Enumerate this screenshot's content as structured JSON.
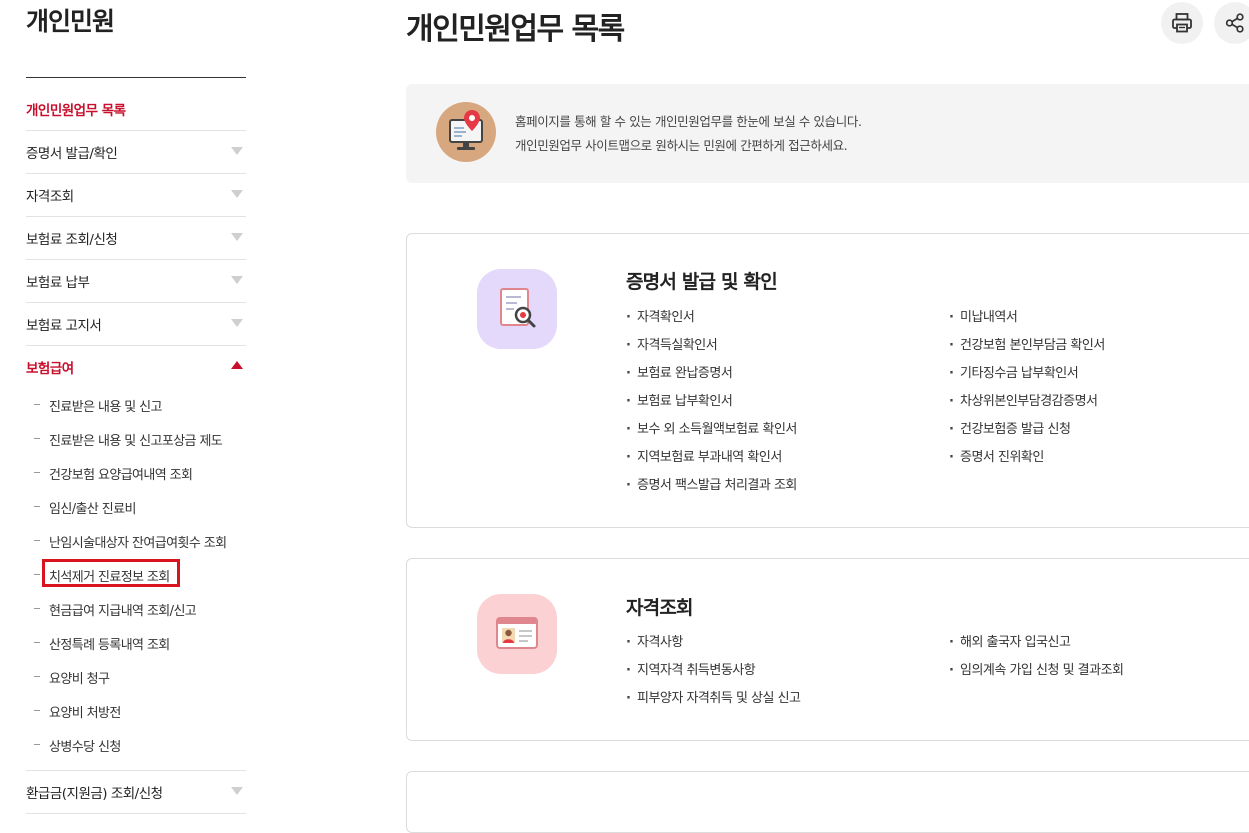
{
  "sidebar": {
    "title": "개인민원",
    "items": [
      {
        "label": "개인민원업무 목록"
      },
      {
        "label": "증명서 발급/확인"
      },
      {
        "label": "자격조회"
      },
      {
        "label": "보험료 조회/신청"
      },
      {
        "label": "보험료 납부"
      },
      {
        "label": "보험료 고지서"
      },
      {
        "label": "보험급여"
      },
      {
        "label": "환급금(지원금) 조회/신청"
      }
    ],
    "submenu": [
      {
        "label": "진료받은 내용 및 신고"
      },
      {
        "label": "진료받은 내용 및 신고포상금 제도"
      },
      {
        "label": "건강보험 요양급여내역 조회"
      },
      {
        "label": "임신/출산 진료비"
      },
      {
        "label": "난임시술대상자 잔여급여횟수 조회"
      },
      {
        "label": "치석제거 진료정보 조회"
      },
      {
        "label": "현금급여 지급내역 조회/신고"
      },
      {
        "label": "산정특례 등록내역 조회"
      },
      {
        "label": "요양비 청구"
      },
      {
        "label": "요양비 처방전"
      },
      {
        "label": "상병수당 신청"
      }
    ]
  },
  "main": {
    "title": "개인민원업무 목록",
    "info": {
      "line1": "홈페이지를 통해 할 수 있는 개인민원업무를 한눈에 보실 수 있습니다.",
      "line2": "개인민원업무 사이트맵으로 원하시는 민원에 간편하게 접근하세요."
    },
    "sections": [
      {
        "title": "증명서 발급 및 확인",
        "left": [
          {
            "label": "자격확인서"
          },
          {
            "label": "자격득실확인서"
          },
          {
            "label": "보험료 완납증명서"
          },
          {
            "label": "보험료 납부확인서"
          },
          {
            "label": "보수 외 소득월액보험료 확인서"
          },
          {
            "label": "지역보험료 부과내역 확인서"
          },
          {
            "label": "증명서 팩스발급 처리결과 조회"
          }
        ],
        "right": [
          {
            "label": "미납내역서"
          },
          {
            "label": "건강보험 본인부담금 확인서"
          },
          {
            "label": "기타징수금 납부확인서"
          },
          {
            "label": "차상위본인부담경감증명서"
          },
          {
            "label": "건강보험증 발급 신청"
          },
          {
            "label": "증명서 진위확인"
          }
        ]
      },
      {
        "title": "자격조회",
        "left": [
          {
            "label": "자격사항"
          },
          {
            "label": "지역자격 취득변동사항"
          },
          {
            "label": "피부양자 자격취득 및 상실 신고"
          }
        ],
        "right": [
          {
            "label": "해외 출국자 입국신고"
          },
          {
            "label": "임의계속 가입 신청 및 결과조회"
          }
        ]
      }
    ]
  },
  "icons": {
    "print": "printer-icon",
    "share": "share-icon",
    "sitemap": "monitor-location-icon",
    "certificate": "document-magnifier-icon",
    "qualification": "id-card-icon"
  },
  "colors": {
    "accent": "#c8102e",
    "highlight_box": "#d9141e",
    "certificate_icon_bg": "#e4d8fb",
    "qualification_icon_bg": "#fcd1d4",
    "sitemap_icon_bg": "#d7a87f"
  }
}
